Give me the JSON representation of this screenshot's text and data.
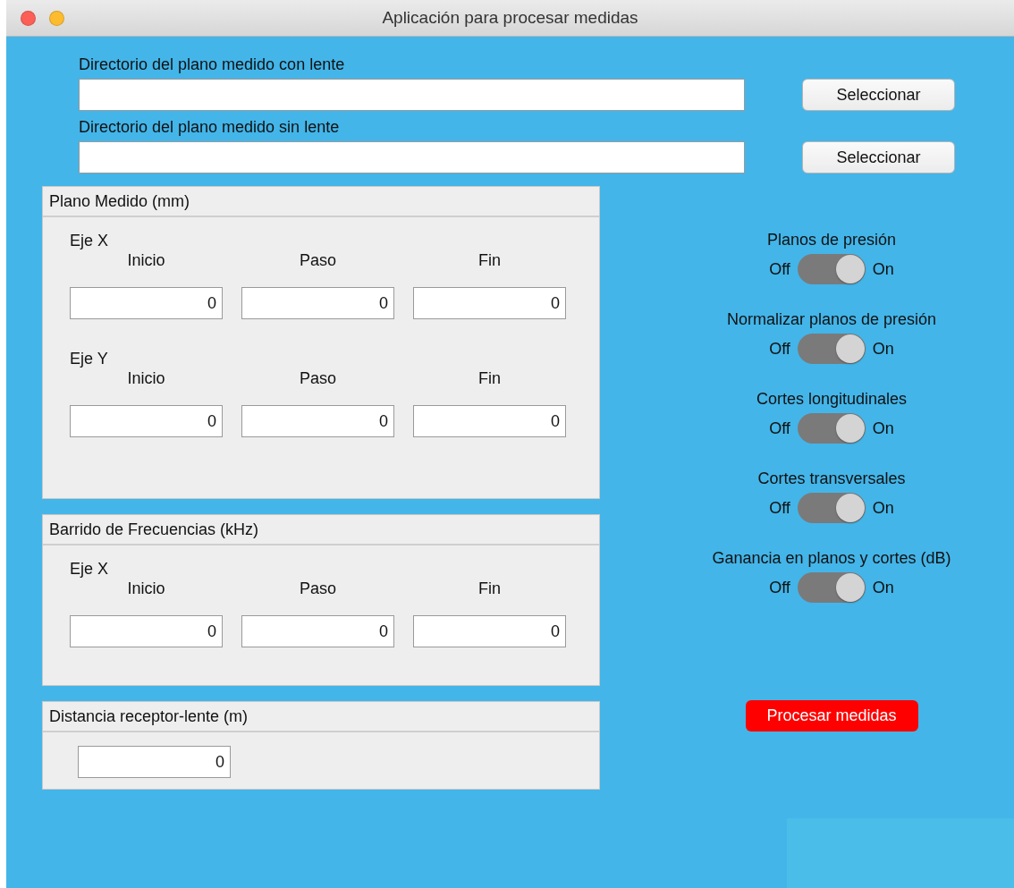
{
  "window": {
    "title": "Aplicación para procesar medidas"
  },
  "directories": [
    {
      "label": "Directorio del plano medido con lente",
      "button": "Seleccionar"
    },
    {
      "label": "Directorio del plano medido sin lente",
      "button": "Seleccionar"
    }
  ],
  "panels": [
    {
      "kind": "axes",
      "title": "Plano Medido (mm)",
      "axes": [
        {
          "label": "Eje X",
          "columns": [
            {
              "label": "Inicio",
              "value": "0"
            },
            {
              "label": "Paso",
              "value": "0"
            },
            {
              "label": "Fin",
              "value": "0"
            }
          ]
        },
        {
          "label": "Eje Y",
          "columns": [
            {
              "label": "Inicio",
              "value": "0"
            },
            {
              "label": "Paso",
              "value": "0"
            },
            {
              "label": "Fin",
              "value": "0"
            }
          ]
        }
      ]
    },
    {
      "kind": "axes",
      "title": "Barrido de Frecuencias (kHz)",
      "axes": [
        {
          "label": "Eje X",
          "columns": [
            {
              "label": "Inicio",
              "value": "0"
            },
            {
              "label": "Paso",
              "value": "0"
            },
            {
              "label": "Fin",
              "value": "0"
            }
          ]
        }
      ]
    },
    {
      "kind": "single",
      "title": "Distancia receptor-lente (m)",
      "value": "0"
    }
  ],
  "toggles": [
    {
      "label": "Planos de presión",
      "off_label": "Off",
      "on_label": "On",
      "on": true
    },
    {
      "label": "Normalizar planos de presión",
      "off_label": "Off",
      "on_label": "On",
      "on": true
    },
    {
      "label": "Cortes longitudinales",
      "off_label": "Off",
      "on_label": "On",
      "on": true
    },
    {
      "label": "Cortes transversales",
      "off_label": "Off",
      "on_label": "On",
      "on": true
    },
    {
      "label": "Ganancia en planos y cortes (dB)",
      "off_label": "Off",
      "on_label": "On",
      "on": true
    }
  ],
  "process_button": {
    "label": "Procesar medidas"
  }
}
